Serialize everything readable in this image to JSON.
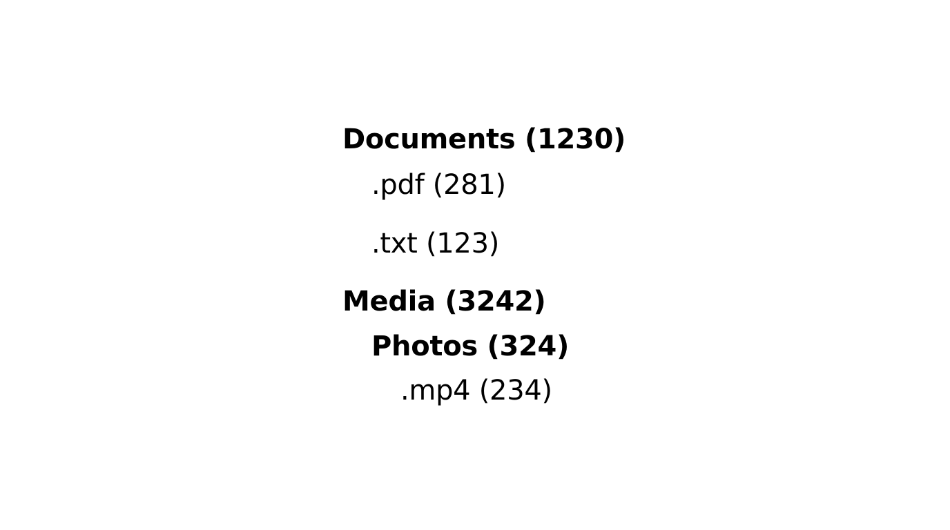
{
  "tree": {
    "documents": {
      "label": "Documents (1230)",
      "children": [
        {
          "label": ".pdf (281)"
        },
        {
          "label": ".txt (123)"
        }
      ]
    },
    "media": {
      "label": "Media (3242)",
      "children": [
        {
          "label": "Photos (324)",
          "children": [
            {
              "label": ".mp4 (234)"
            }
          ]
        }
      ]
    }
  }
}
